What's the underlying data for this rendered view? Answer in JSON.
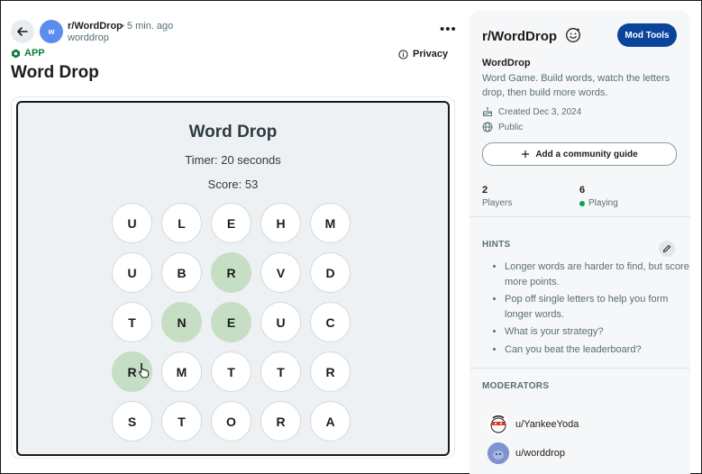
{
  "post": {
    "avatar_letter": "w",
    "subreddit": "r/WordDrop",
    "time": "• 5 min. ago",
    "author": "worddrop",
    "more_label": "•••",
    "app_label": "APP",
    "title": "Word Drop",
    "privacy_label": "Privacy"
  },
  "game": {
    "title": "Word Drop",
    "timer": "Timer: 20 seconds",
    "score": "Score: 53",
    "selected_color": "#c6dfc4",
    "grid": [
      [
        {
          "l": "U",
          "s": false
        },
        {
          "l": "L",
          "s": false
        },
        {
          "l": "E",
          "s": false
        },
        {
          "l": "H",
          "s": false
        },
        {
          "l": "M",
          "s": false
        }
      ],
      [
        {
          "l": "U",
          "s": false
        },
        {
          "l": "B",
          "s": false
        },
        {
          "l": "R",
          "s": true
        },
        {
          "l": "V",
          "s": false
        },
        {
          "l": "D",
          "s": false
        }
      ],
      [
        {
          "l": "T",
          "s": false
        },
        {
          "l": "N",
          "s": true
        },
        {
          "l": "E",
          "s": true
        },
        {
          "l": "U",
          "s": false
        },
        {
          "l": "C",
          "s": false
        }
      ],
      [
        {
          "l": "R",
          "s": true
        },
        {
          "l": "M",
          "s": false
        },
        {
          "l": "T",
          "s": false
        },
        {
          "l": "T",
          "s": false
        },
        {
          "l": "R",
          "s": false
        }
      ],
      [
        {
          "l": "S",
          "s": false
        },
        {
          "l": "T",
          "s": false
        },
        {
          "l": "O",
          "s": false
        },
        {
          "l": "R",
          "s": false
        },
        {
          "l": "A",
          "s": false
        }
      ]
    ]
  },
  "sidebar": {
    "title": "r/WordDrop",
    "mod_tools_label": "Mod Tools",
    "community_name": "WordDrop",
    "description": "Word Game. Build words, watch the letters drop, then build more words.",
    "created": "Created Dec 3, 2024",
    "visibility": "Public",
    "guide_label": "Add a community guide",
    "stats": [
      {
        "value": "2",
        "label": "Players"
      },
      {
        "value": "6",
        "label": "Playing"
      }
    ],
    "hints_heading": "HINTS",
    "hints": [
      "Longer words are harder to find, but score more points.",
      "Pop off single letters to help you form longer words.",
      "What is your strategy?",
      "Can you beat the leaderboard?"
    ],
    "moderators_heading": "MODERATORS",
    "moderators": [
      {
        "name": "u/YankeeYoda"
      },
      {
        "name": "u/worddrop"
      }
    ]
  }
}
